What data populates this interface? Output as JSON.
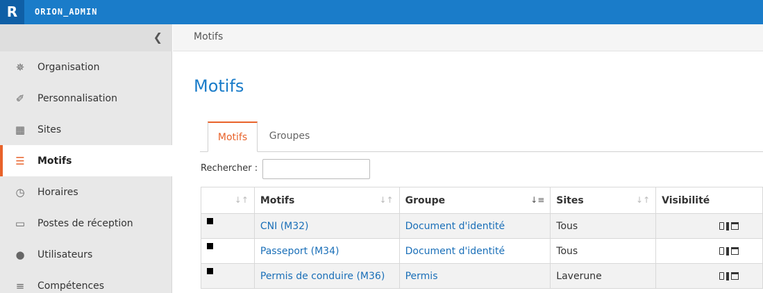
{
  "header": {
    "logo_letter": "R",
    "brand": "ORION_ADMIN"
  },
  "sidebar": {
    "collapse_icon": "chevron-left-icon",
    "items": [
      {
        "label": "Organisation",
        "icon": "gear-icon",
        "glyph": "✵"
      },
      {
        "label": "Personnalisation",
        "icon": "brush-icon",
        "glyph": "✐"
      },
      {
        "label": "Sites",
        "icon": "building-icon",
        "glyph": "▦"
      },
      {
        "label": "Motifs",
        "icon": "clipboard-icon",
        "glyph": "☰"
      },
      {
        "label": "Horaires",
        "icon": "clock-icon",
        "glyph": "◷"
      },
      {
        "label": "Postes de réception",
        "icon": "monitor-icon",
        "glyph": "▭"
      },
      {
        "label": "Utilisateurs",
        "icon": "user-icon",
        "glyph": "●"
      },
      {
        "label": "Compétences",
        "icon": "sliders-icon",
        "glyph": "≡"
      }
    ],
    "active_index": 3
  },
  "breadcrumb": "Motifs",
  "page_title": "Motifs",
  "tabs": [
    {
      "label": "Motifs",
      "active": true
    },
    {
      "label": "Groupes",
      "active": false
    }
  ],
  "search": {
    "label": "Rechercher :",
    "value": ""
  },
  "table": {
    "columns": [
      "",
      "Motifs",
      "Groupe",
      "Sites",
      "Visibilité"
    ],
    "rows": [
      {
        "color": "#000000",
        "motif": "CNI (M32)",
        "groupe": "Document d'identité",
        "sites": "Tous"
      },
      {
        "color": "#000000",
        "motif": "Passeport (M34)",
        "groupe": "Document d'identité",
        "sites": "Tous"
      },
      {
        "color": "#000000",
        "motif": "Permis de conduire (M36)",
        "groupe": "Permis",
        "sites": "Laverune"
      }
    ]
  },
  "colors": {
    "primary": "#1a7cc9",
    "accent": "#e8622a"
  }
}
